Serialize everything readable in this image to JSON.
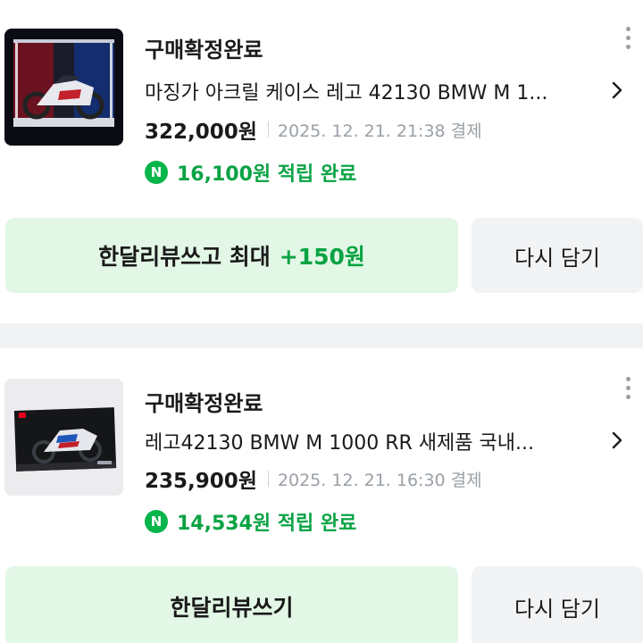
{
  "orders": [
    {
      "status": "구매확정완료",
      "title": "마징가 아크릴 케이스 레고 42130 BMW M 1...",
      "price": "322,000원",
      "paid_at": "2025. 12. 21. 21:38 결제",
      "point_badge": "N",
      "points": "16,100원 적립 완료",
      "review_button": "한달리뷰쓰고 최대",
      "review_bonus": "+150원",
      "cart_button": "다시 담기",
      "thumbnail": "lego-bmw-motorcycle-in-acrylic-case-photo"
    },
    {
      "status": "구매확정완료",
      "title": "레고42130 BMW M 1000 RR 새제품 국내...",
      "price": "235,900원",
      "paid_at": "2025. 12. 21. 16:30 결제",
      "point_badge": "N",
      "points": "14,534원 적립 완료",
      "review_button": "한달리뷰쓰기",
      "review_bonus": "",
      "cart_button": "다시 담기",
      "thumbnail": "lego-bmw-m1000rr-box-photo"
    }
  ],
  "colors": {
    "point_green": "#0aa344",
    "review_button_bg": "#e2f7e6",
    "cart_button_bg": "#f2f3f5",
    "npay_badge": "#08b54a"
  }
}
